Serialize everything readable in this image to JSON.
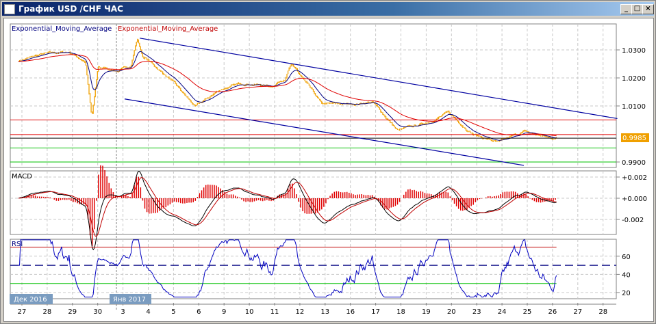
{
  "window": {
    "title": "График USD /CHF  ЧАС",
    "minimize": "_",
    "maximize": "□",
    "close": "×"
  },
  "legend": {
    "ema1": "Exponential_Moving_Average",
    "ema2": "Exponential_Moving_Average"
  },
  "macd_label": "MACD",
  "rsi_label": "RSI",
  "current_price": "0.9985",
  "months": {
    "dec": "Дек 2016",
    "jan": "Янв 2017"
  },
  "chart_data": {
    "type": "line",
    "x_labels": [
      "27",
      "28",
      "29",
      "30",
      "3",
      "4",
      "5",
      "6",
      "9",
      "10",
      "11",
      "12",
      "13",
      "16",
      "17",
      "18",
      "19",
      "20",
      "23",
      "24",
      "25",
      "26",
      "27",
      "28"
    ],
    "price_axis": {
      "ticks": [
        "1.0300",
        "1.0200",
        "1.0100",
        "0.9900"
      ],
      "values": [
        1.03,
        1.02,
        1.01,
        0.99
      ],
      "ylim": [
        0.9878,
        1.0385
      ]
    },
    "price_waypoints": [
      1.0262,
      1.0285,
      1.0292,
      1.024,
      1.0225,
      1.0272,
      1.0195,
      1.0095,
      1.016,
      1.0182,
      1.017,
      1.0225,
      1.0105,
      1.0105,
      1.0115,
      1.0012,
      1.0035,
      1.0075,
      1.0,
      0.9968,
      1.0008,
      0.9985
    ],
    "spikes": [
      {
        "day": 2.9,
        "value": 1.006
      },
      {
        "day": 4.7,
        "value": 1.034
      },
      {
        "day": 10.8,
        "value": 1.025
      }
    ],
    "levels": [
      {
        "value": 1.005,
        "color": "#e00000"
      },
      {
        "value": 0.9998,
        "color": "#e00000"
      },
      {
        "value": 0.9985,
        "color": "#000000"
      },
      {
        "value": 0.995,
        "color": "#00c000"
      },
      {
        "value": 0.99,
        "color": "#00c000"
      }
    ],
    "channel": [
      {
        "from": [
          4.8,
          1.0342
        ],
        "to": [
          23.7,
          1.0055
        ]
      },
      {
        "from": [
          4.2,
          1.0125
        ],
        "to": [
          20.0,
          0.9888
        ]
      }
    ],
    "macd_axis": {
      "ticks": [
        "+0.002",
        "+0.000",
        "-0.002"
      ],
      "values": [
        0.002,
        0,
        -0.002
      ]
    },
    "rsi_axis": {
      "ticks": [
        "60",
        "40",
        "20"
      ],
      "values": [
        60,
        40,
        20
      ],
      "overbought": 70,
      "oversold": 30,
      "mid": 50
    },
    "colors": {
      "price": "#f0a000",
      "ema_fast": "#000080",
      "ema_slow": "#e00000",
      "hist": "#e00000",
      "rsi": "#0000c0"
    }
  }
}
